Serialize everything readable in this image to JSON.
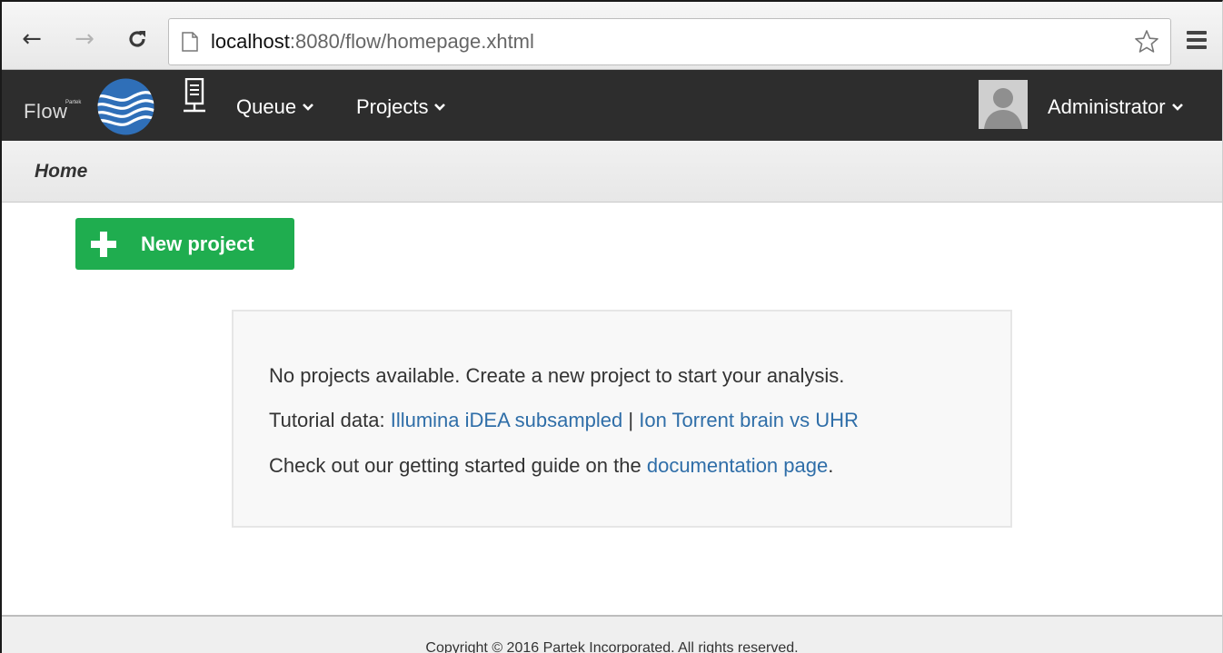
{
  "browser": {
    "url_host": "localhost",
    "url_rest": ":8080/flow/homepage.xhtml",
    "back_icon": "back-arrow-icon",
    "forward_icon": "forward-arrow-icon",
    "reload_icon": "reload-icon",
    "page_icon": "page-icon",
    "star_icon": "star-icon",
    "menu_icon": "hamburger-menu-icon"
  },
  "navbar": {
    "brand_small": "Partek",
    "brand": "Flow",
    "server_icon": "server-icon",
    "queue_label": "Queue",
    "projects_label": "Projects",
    "user_label": "Administrator",
    "bg_color": "#2d2d2d"
  },
  "breadcrumb": {
    "current": "Home"
  },
  "actions": {
    "new_project_label": "New project",
    "accent": "#1fad4f"
  },
  "empty_state": {
    "line1": "No projects available. Create a new project to start your analysis.",
    "tutorial_prefix": "Tutorial data: ",
    "tutorial_link1": "Illumina iDEA subsampled",
    "tutorial_separator": " | ",
    "tutorial_link2": "Ion Torrent brain vs UHR",
    "guide_prefix": "Check out our getting started guide on the ",
    "guide_link": "documentation page",
    "guide_suffix": ".",
    "link_color": "#2f6ea8"
  },
  "footer": {
    "copyright": "Copyright © 2016 Partek Incorporated. All rights reserved."
  }
}
